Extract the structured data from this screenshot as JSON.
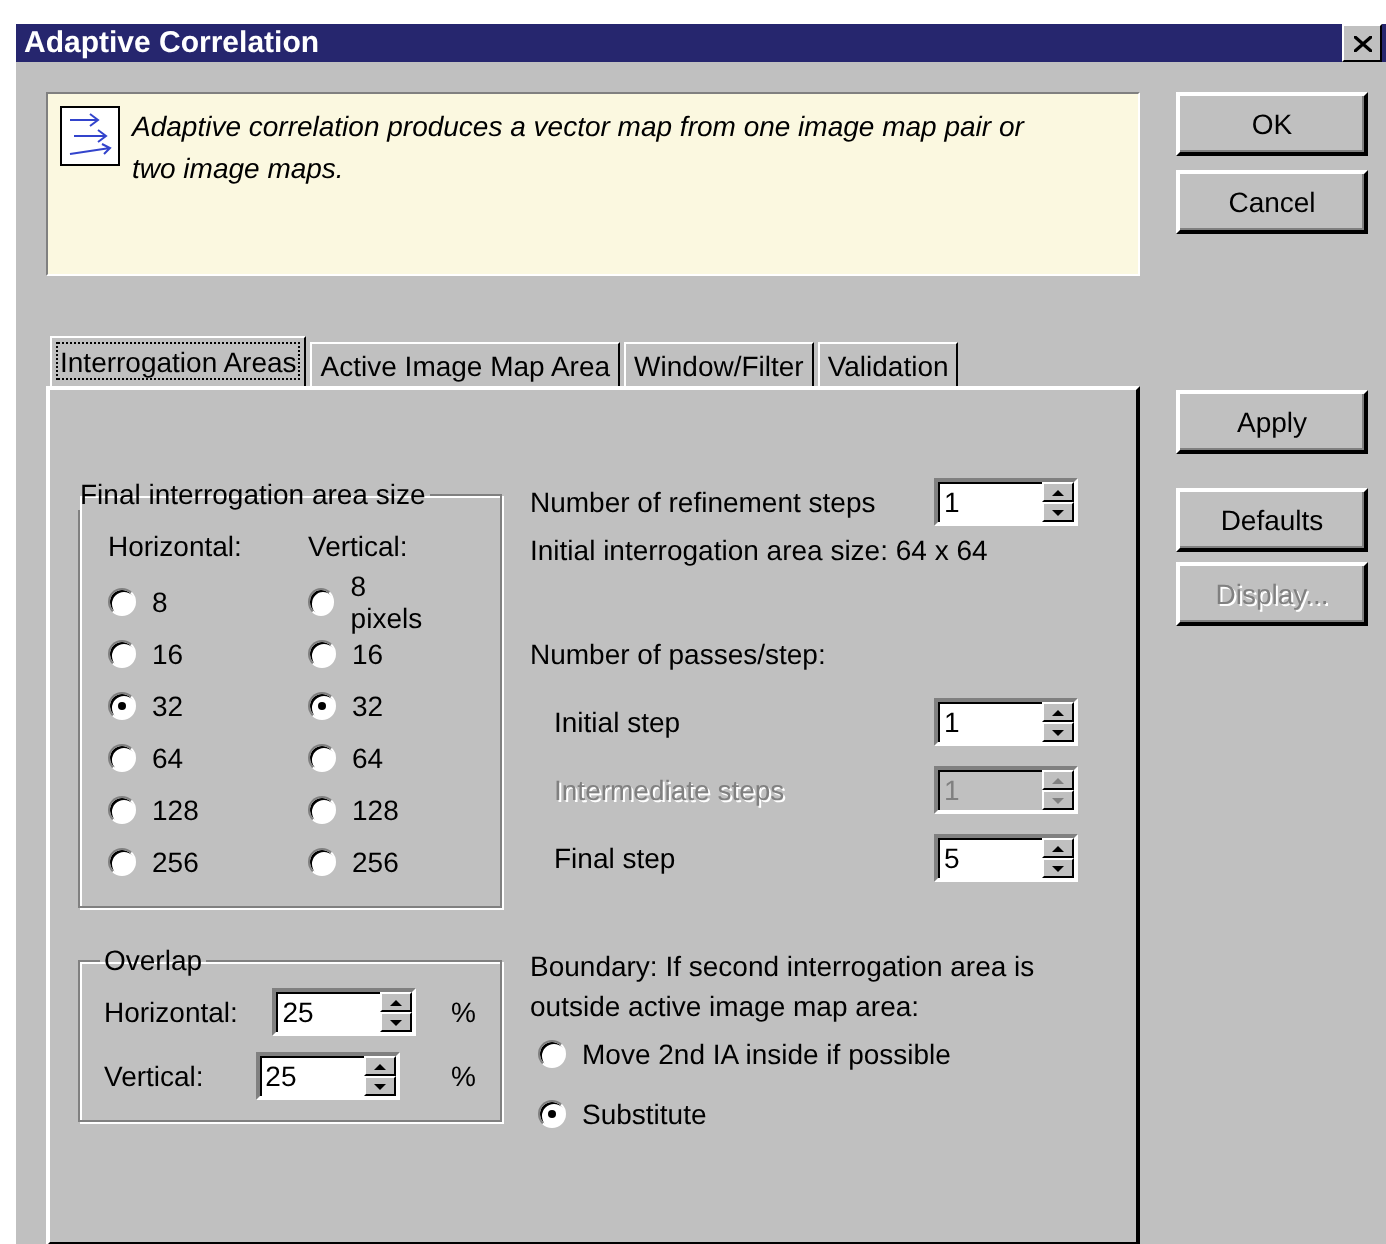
{
  "window": {
    "title": "Adaptive Correlation"
  },
  "info": {
    "text": "Adaptive correlation produces a vector map from one image map pair or two image maps."
  },
  "dialog_buttons": [
    {
      "label": "OK",
      "disabled": false
    },
    {
      "label": "Cancel",
      "disabled": false
    }
  ],
  "tabs": [
    {
      "label": "Interrogation Areas",
      "selected": true
    },
    {
      "label": "Active Image Map Area",
      "selected": false
    },
    {
      "label": "Window/Filter",
      "selected": false
    },
    {
      "label": "Validation",
      "selected": false
    }
  ],
  "side_buttons": [
    {
      "label": "Apply",
      "disabled": false
    },
    {
      "label": "Defaults",
      "disabled": false
    },
    {
      "label": "Display...",
      "disabled": true
    }
  ],
  "final_size": {
    "title": "Final interrogation area size",
    "columns": [
      {
        "header": "Horizontal:",
        "options": [
          {
            "label": "8",
            "selected": false
          },
          {
            "label": "16",
            "selected": false
          },
          {
            "label": "32",
            "selected": true
          },
          {
            "label": "64",
            "selected": false
          },
          {
            "label": "128",
            "selected": false
          },
          {
            "label": "256",
            "selected": false
          }
        ]
      },
      {
        "header": "Vertical:",
        "options": [
          {
            "label": "8 pixels",
            "selected": false
          },
          {
            "label": "16",
            "selected": false
          },
          {
            "label": "32",
            "selected": true
          },
          {
            "label": "64",
            "selected": false
          },
          {
            "label": "128",
            "selected": false
          },
          {
            "label": "256",
            "selected": false
          }
        ]
      }
    ]
  },
  "refinement": {
    "label": "Number of refinement steps",
    "value": "1"
  },
  "initial_size": "Initial interrogation area size: 64 x 64",
  "passes": {
    "title": "Number of passes/step:",
    "rows": [
      {
        "label": "Initial step",
        "value": "1",
        "disabled": false
      },
      {
        "label": "Intermediate steps",
        "value": "1",
        "disabled": true
      },
      {
        "label": "Final step",
        "value": "5",
        "disabled": false
      }
    ]
  },
  "overlap": {
    "title": "Overlap",
    "rows": [
      {
        "label": "Horizontal:",
        "value": "25",
        "unit": "%"
      },
      {
        "label": "Vertical:",
        "value": "25",
        "unit": "%"
      }
    ]
  },
  "boundary": {
    "text": "Boundary: If second interrogation area is outside active image map area:",
    "options": [
      {
        "label": "Move 2nd IA inside if possible",
        "selected": false
      },
      {
        "label": "Substitute",
        "selected": true
      }
    ]
  }
}
